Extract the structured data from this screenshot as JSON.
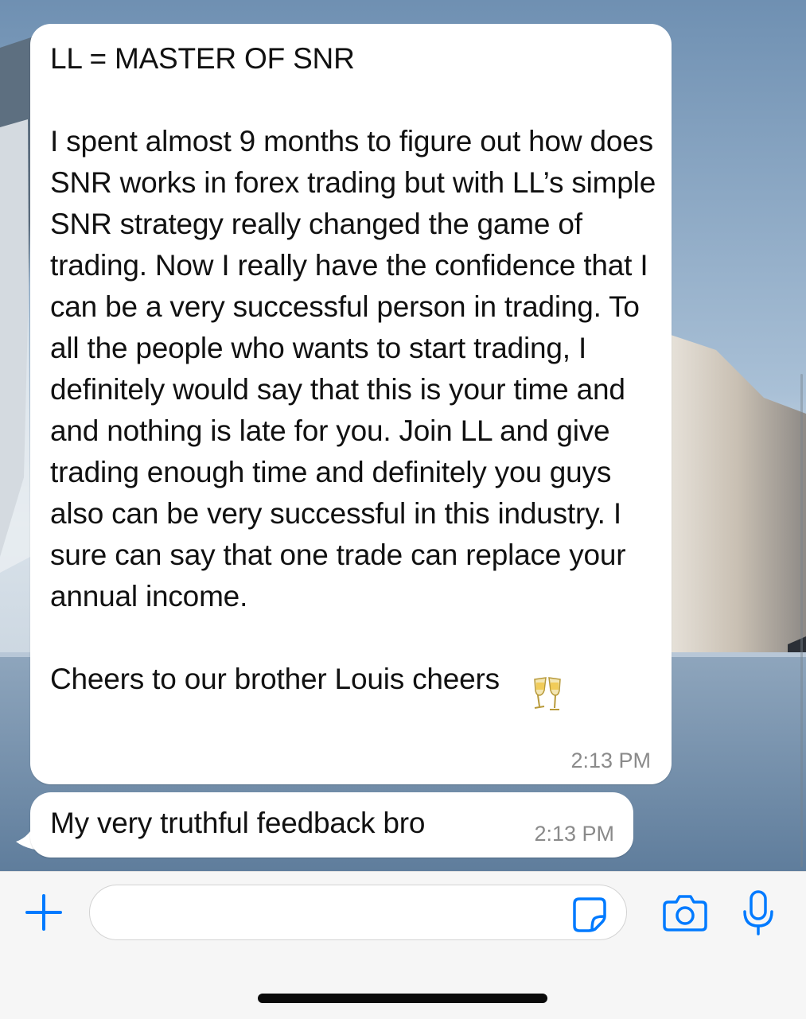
{
  "chat": {
    "messages": [
      {
        "text": "LL = MASTER OF SNR\n\nI spent almost 9 months to figure out how does SNR works in forex trading but with LL’s simple SNR strategy really changed the game of trading. Now I really have the confidence that I can be a very successful person in trading. To all the people who wants to start trading, I definitely would say that this is your time and and nothing is late for you. Join LL and give trading enough time and definitely you guys also can be very successful in this industry. I sure can say that one trade can replace your annual income.\n\nCheers to our brother Louis cheers ",
        "emoji": "clinking-glasses",
        "time": "2:13 PM"
      },
      {
        "text": "My very truthful feedback bro",
        "time": "2:13 PM"
      }
    ]
  },
  "composer": {
    "input_value": "",
    "icons": [
      "plus-icon",
      "sticker-icon",
      "camera-icon",
      "microphone-icon"
    ],
    "accent_color": "#007aff"
  },
  "colors": {
    "bubble": "#ffffff",
    "timestamp": "#8a8a8a",
    "composer_bg": "#f6f6f6"
  }
}
